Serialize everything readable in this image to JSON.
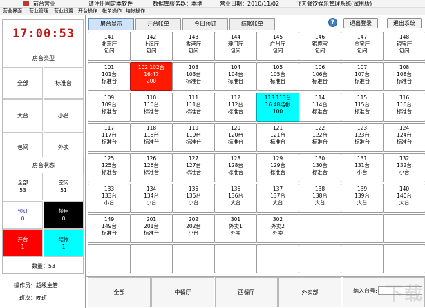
{
  "titlebar": {
    "left_label": "前台营业",
    "tip": "请注册固定本软件",
    "server": "数据库服务器：本地",
    "business_date": "营业日期：2010/11/02",
    "app_name": "飞天餐饮娱乐管理系统(试用版)"
  },
  "menu": [
    "营业界面",
    "营业管理",
    "营业设置",
    "开台操作",
    "帐单操作",
    "结帐操作"
  ],
  "clock": "17:00:53",
  "room_type": {
    "title": "房台类型",
    "buttons": [
      "全部",
      "标准台",
      "大台",
      "小台",
      "包间",
      "外卖"
    ]
  },
  "room_status": {
    "title": "房台状态",
    "items": [
      {
        "label": "全部",
        "count": "53"
      },
      {
        "label": "空闲",
        "count": "51"
      },
      {
        "label": "预订",
        "count": "0"
      },
      {
        "label": "禁用",
        "count": "0"
      },
      {
        "label": "开台",
        "count": "1"
      },
      {
        "label": "结帐",
        "count": "1"
      }
    ],
    "quantity": "数量：53"
  },
  "operator": "操作员：超级主管",
  "shift": "班次：晚班",
  "tabs": [
    "房台显示",
    "开台帐单",
    "今日预订",
    "结帐帐单"
  ],
  "actions": {
    "help": "?",
    "logout": "退出登录",
    "exit": "退出系统"
  },
  "tiles": [
    {
      "l1": "141",
      "l2": "北京厅",
      "l3": "包间"
    },
    {
      "l1": "142",
      "l2": "上海厅",
      "l3": "包间"
    },
    {
      "l1": "143",
      "l2": "香港厅",
      "l3": "包间"
    },
    {
      "l1": "144",
      "l2": "澳门厅",
      "l3": "包间"
    },
    {
      "l1": "145",
      "l2": "广州厅",
      "l3": "包间"
    },
    {
      "l1": "146",
      "l2": "银鹿宝",
      "l3": "包间"
    },
    {
      "l1": "147",
      "l2": "金宝厅",
      "l3": "包间"
    },
    {
      "l1": "148",
      "l2": "银宝厅",
      "l3": "包间"
    },
    {
      "l1": "101",
      "l2": "101台",
      "l3": "标准台"
    },
    {
      "l1": "102  102台",
      "l2": "16:47",
      "l3": "200",
      "state": "busy"
    },
    {
      "l1": "103",
      "l2": "103台",
      "l3": "标准台"
    },
    {
      "l1": "104",
      "l2": "104台",
      "l3": "标准台"
    },
    {
      "l1": "105",
      "l2": "105台",
      "l3": "标准台"
    },
    {
      "l1": "106",
      "l2": "106台",
      "l3": "标准台"
    },
    {
      "l1": "107",
      "l2": "107台",
      "l3": "标准台"
    },
    {
      "l1": "108",
      "l2": "108台",
      "l3": "标准台"
    },
    {
      "l1": "109",
      "l2": "109台",
      "l3": "标准台"
    },
    {
      "l1": "110",
      "l2": "110台",
      "l3": "标准台"
    },
    {
      "l1": "111",
      "l2": "111台",
      "l3": "标准台"
    },
    {
      "l1": "112",
      "l2": "112台",
      "l3": "标准台"
    },
    {
      "l1": "113  113台",
      "l2": "16:48结帐",
      "l3": "100",
      "state": "checkout"
    },
    {
      "l1": "114",
      "l2": "114台",
      "l3": "标准台"
    },
    {
      "l1": "115",
      "l2": "115台",
      "l3": "标准台"
    },
    {
      "l1": "116",
      "l2": "116台",
      "l3": "标准台"
    },
    {
      "l1": "117",
      "l2": "117台",
      "l3": "标准台"
    },
    {
      "l1": "118",
      "l2": "118台",
      "l3": "标准台"
    },
    {
      "l1": "119",
      "l2": "119台",
      "l3": "标准台"
    },
    {
      "l1": "120",
      "l2": "120台",
      "l3": "标准台"
    },
    {
      "l1": "121",
      "l2": "121台",
      "l3": "标准台"
    },
    {
      "l1": "122",
      "l2": "122台",
      "l3": "标准台"
    },
    {
      "l1": "123",
      "l2": "123台",
      "l3": "标准台"
    },
    {
      "l1": "124",
      "l2": "124台",
      "l3": "标准台"
    },
    {
      "l1": "125",
      "l2": "125台",
      "l3": "标准台"
    },
    {
      "l1": "126",
      "l2": "126台",
      "l3": "标准台"
    },
    {
      "l1": "127",
      "l2": "127台",
      "l3": "标准台"
    },
    {
      "l1": "128",
      "l2": "128台",
      "l3": "标准台"
    },
    {
      "l1": "129",
      "l2": "129台",
      "l3": "标准台"
    },
    {
      "l1": "130",
      "l2": "130台",
      "l3": "标准台"
    },
    {
      "l1": "131",
      "l2": "131台",
      "l3": "小台"
    },
    {
      "l1": "132",
      "l2": "132台",
      "l3": "小台"
    },
    {
      "l1": "133",
      "l2": "133台",
      "l3": "小台"
    },
    {
      "l1": "134",
      "l2": "134台",
      "l3": "小台"
    },
    {
      "l1": "135",
      "l2": "135台",
      "l3": "小台"
    },
    {
      "l1": "136",
      "l2": "136台",
      "l3": "大台"
    },
    {
      "l1": "137",
      "l2": "137台",
      "l3": "大台"
    },
    {
      "l1": "138",
      "l2": "138台",
      "l3": "大台"
    },
    {
      "l1": "139",
      "l2": "139台",
      "l3": "大台"
    },
    {
      "l1": "140",
      "l2": "140台",
      "l3": "大台"
    },
    {
      "l1": "149",
      "l2": "149台",
      "l3": "标准台"
    },
    {
      "l1": "201",
      "l2": "201台",
      "l3": "标准台"
    },
    {
      "l1": "202",
      "l2": "202台",
      "l3": "小台"
    },
    {
      "l1": "301",
      "l2": "外卖1",
      "l3": "外卖"
    },
    {
      "l1": "302",
      "l2": "外卖2",
      "l3": "外卖"
    },
    {
      "l1": "",
      "l2": "",
      "l3": ""
    },
    {
      "l1": "",
      "l2": "",
      "l3": ""
    },
    {
      "l1": "",
      "l2": "",
      "l3": ""
    },
    {
      "l1": "",
      "l2": "",
      "l3": ""
    },
    {
      "l1": "",
      "l2": "",
      "l3": ""
    },
    {
      "l1": "",
      "l2": "",
      "l3": ""
    },
    {
      "l1": "",
      "l2": "",
      "l3": ""
    },
    {
      "l1": "",
      "l2": "",
      "l3": ""
    },
    {
      "l1": "",
      "l2": "",
      "l3": ""
    },
    {
      "l1": "",
      "l2": "",
      "l3": ""
    },
    {
      "l1": "",
      "l2": "",
      "l3": ""
    }
  ],
  "bottom": {
    "areas": [
      "全部",
      "中餐厅",
      "西餐厅",
      "外卖部"
    ],
    "input_label": "输入台号:",
    "input_value": ""
  },
  "colors": {
    "busy": "#ff1a00",
    "checkout": "#00ffff",
    "disabled": "#000000",
    "clock": "#c01818"
  }
}
